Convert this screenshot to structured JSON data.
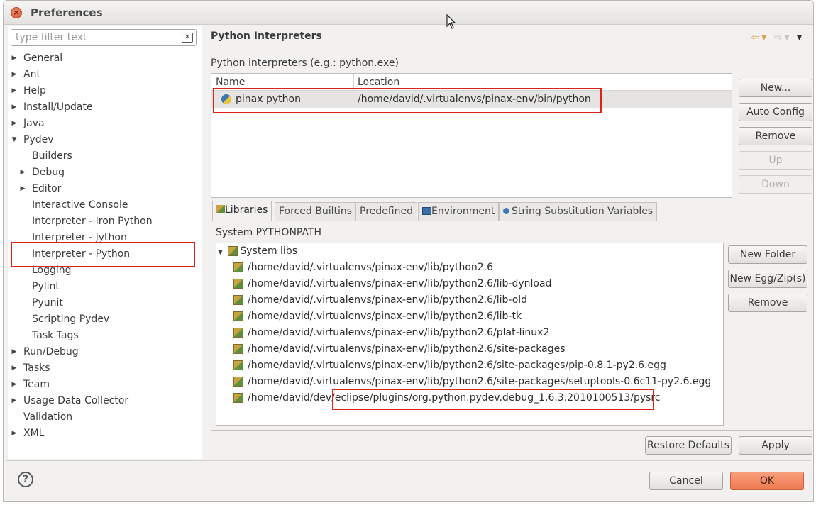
{
  "window": {
    "title": "Preferences"
  },
  "filter": {
    "placeholder": "type filter text"
  },
  "tree": [
    {
      "label": "General",
      "twisty": "▶"
    },
    {
      "label": "Ant",
      "twisty": "▶"
    },
    {
      "label": "Help",
      "twisty": "▶"
    },
    {
      "label": "Install/Update",
      "twisty": "▶"
    },
    {
      "label": "Java",
      "twisty": "▶"
    },
    {
      "label": "Pydev",
      "twisty": "▼"
    },
    {
      "label": "Builders",
      "twisty": ""
    },
    {
      "label": "Debug",
      "twisty": "▶"
    },
    {
      "label": "Editor",
      "twisty": "▶"
    },
    {
      "label": "Interactive Console",
      "twisty": ""
    },
    {
      "label": "Interpreter - Iron Python",
      "twisty": ""
    },
    {
      "label": "Interpreter - Jython",
      "twisty": ""
    },
    {
      "label": "Interpreter - Python",
      "twisty": ""
    },
    {
      "label": "Logging",
      "twisty": ""
    },
    {
      "label": "Pylint",
      "twisty": ""
    },
    {
      "label": "Pyunit",
      "twisty": ""
    },
    {
      "label": "Scripting Pydev",
      "twisty": ""
    },
    {
      "label": "Task Tags",
      "twisty": ""
    },
    {
      "label": "Run/Debug",
      "twisty": "▶"
    },
    {
      "label": "Tasks",
      "twisty": "▶"
    },
    {
      "label": "Team",
      "twisty": "▶"
    },
    {
      "label": "Usage Data Collector",
      "twisty": "▶"
    },
    {
      "label": "Validation",
      "twisty": ""
    },
    {
      "label": "XML",
      "twisty": "▶"
    }
  ],
  "page": {
    "title": "Python Interpreters",
    "section_label": "Python interpreters (e.g.: python.exe)",
    "table": {
      "columns": [
        "Name",
        "Location"
      ],
      "rows": [
        {
          "name": "pinax python",
          "location": "/home/david/.virtualenvs/pinax-env/bin/python"
        }
      ]
    },
    "buttons": {
      "new": "New...",
      "auto_config": "Auto Config",
      "remove": "Remove",
      "up": "Up",
      "down": "Down"
    },
    "tabs": [
      "Libraries",
      "Forced Builtins",
      "Predefined",
      "Environment",
      "String Substitution Variables"
    ],
    "libraries": {
      "label": "System PYTHONPATH",
      "root": "System libs",
      "paths": [
        "/home/david/.virtualenvs/pinax-env/lib/python2.6",
        "/home/david/.virtualenvs/pinax-env/lib/python2.6/lib-dynload",
        "/home/david/.virtualenvs/pinax-env/lib/python2.6/lib-old",
        "/home/david/.virtualenvs/pinax-env/lib/python2.6/lib-tk",
        "/home/david/.virtualenvs/pinax-env/lib/python2.6/plat-linux2",
        "/home/david/.virtualenvs/pinax-env/lib/python2.6/site-packages",
        "/home/david/.virtualenvs/pinax-env/lib/python2.6/site-packages/pip-0.8.1-py2.6.egg",
        "/home/david/.virtualenvs/pinax-env/lib/python2.6/site-packages/setuptools-0.6c11-py2.6.egg",
        "/home/david/dev/eclipse/plugins/org.python.pydev.debug_1.6.3.2010100513/pysrc"
      ],
      "buttons": {
        "new_folder": "New Folder",
        "new_egg": "New Egg/Zip(s)",
        "remove": "Remove"
      }
    },
    "restore_defaults": "Restore Defaults",
    "apply": "Apply"
  },
  "footer": {
    "help": "?",
    "cancel": "Cancel",
    "ok": "OK"
  },
  "colors": {
    "highlight_box": "#e0201b",
    "ok_button": "#ee7a51"
  }
}
